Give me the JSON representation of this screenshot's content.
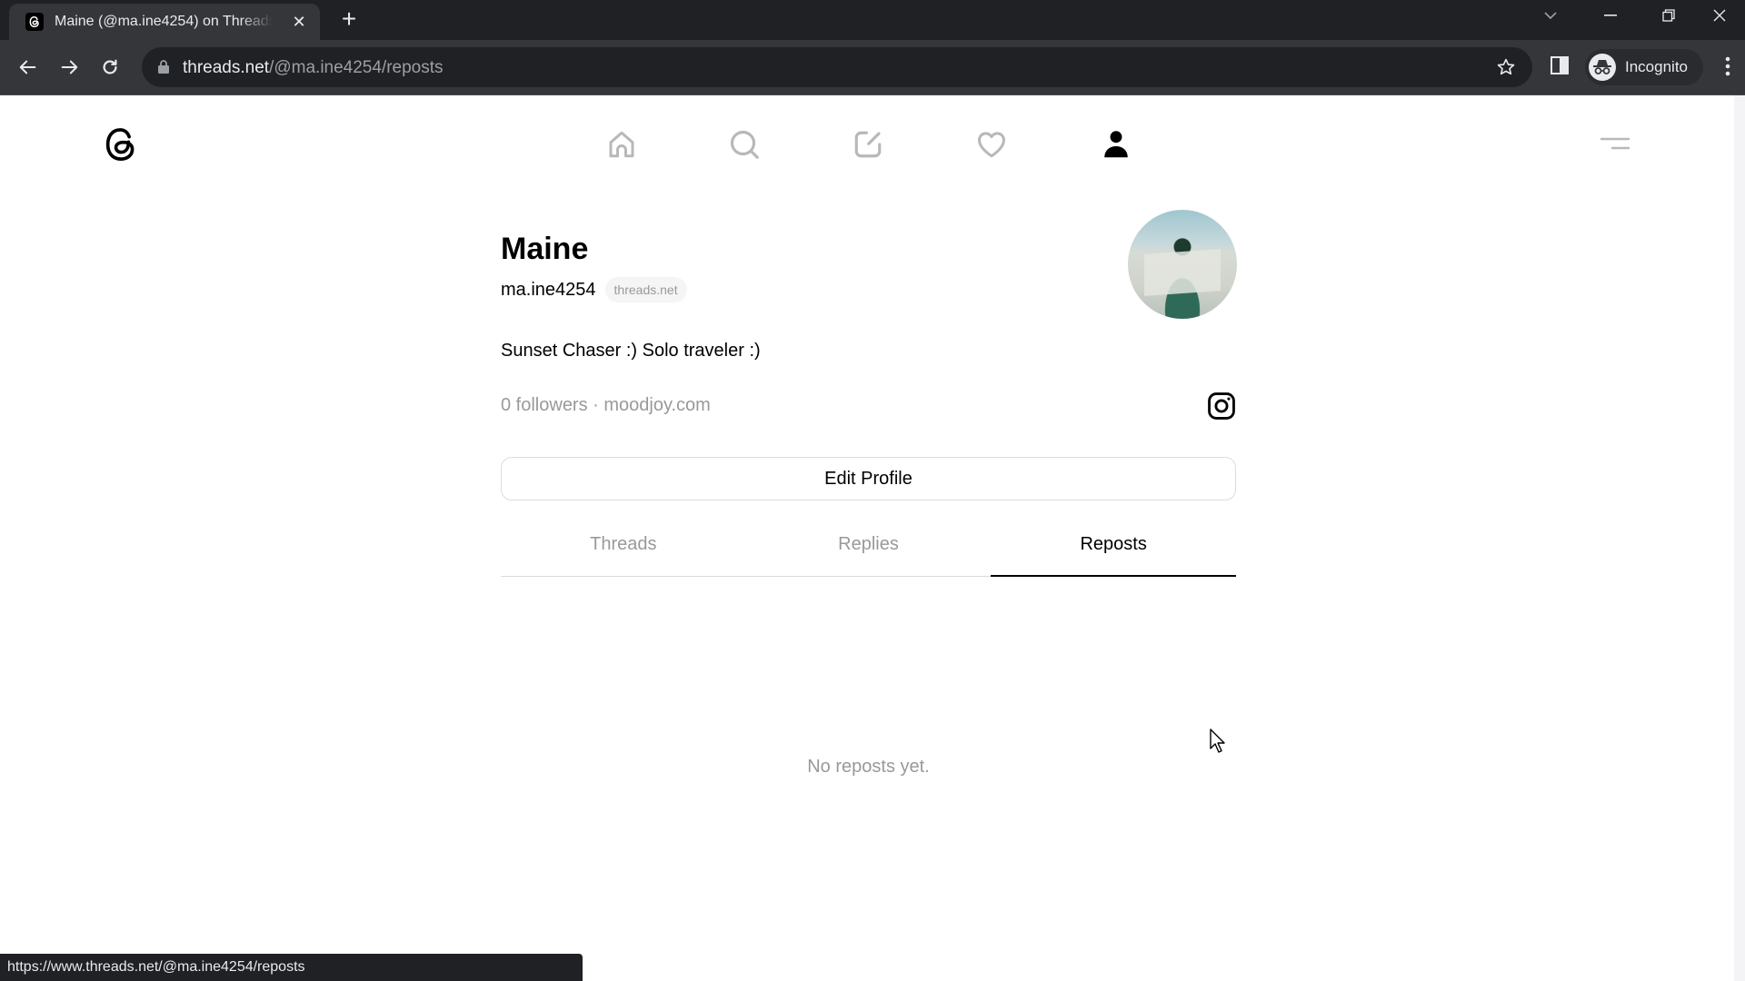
{
  "browser": {
    "tab_title": "Maine (@ma.ine4254) on Threads",
    "url_host": "threads.net",
    "url_path": "/@ma.ine4254/reposts",
    "profile_label": "Incognito",
    "status_url": "https://www.threads.net/@ma.ine4254/reposts",
    "icons": [
      "back-icon",
      "forward-icon",
      "reload-icon",
      "lock-icon",
      "star-icon",
      "side-panel-icon",
      "incognito-icon",
      "kebab-menu-icon",
      "tab-list-icon",
      "minimize-icon",
      "restore-icon",
      "close-icon",
      "new-tab-icon"
    ]
  },
  "app": {
    "nav": {
      "items": [
        {
          "name": "home",
          "icon": "home-icon",
          "active": false
        },
        {
          "name": "search",
          "icon": "search-icon",
          "active": false
        },
        {
          "name": "compose",
          "icon": "compose-icon",
          "active": false
        },
        {
          "name": "activity",
          "icon": "heart-icon",
          "active": false
        },
        {
          "name": "profile",
          "icon": "person-icon",
          "active": true
        }
      ],
      "inactive_color": "#b8b8b8",
      "active_color": "#000000"
    }
  },
  "profile": {
    "name": "Maine",
    "handle": "ma.ine4254",
    "domain_chip": "threads.net",
    "bio": "Sunset Chaser :) Solo traveler :)",
    "meta": "0 followers · moodjoy.com",
    "followers_count": "0 followers",
    "link": "moodjoy.com",
    "edit_button": "Edit Profile",
    "tabs": [
      {
        "label": "Threads",
        "active": false
      },
      {
        "label": "Replies",
        "active": false
      },
      {
        "label": "Reposts",
        "active": true
      }
    ],
    "empty_message": "No reposts yet."
  }
}
